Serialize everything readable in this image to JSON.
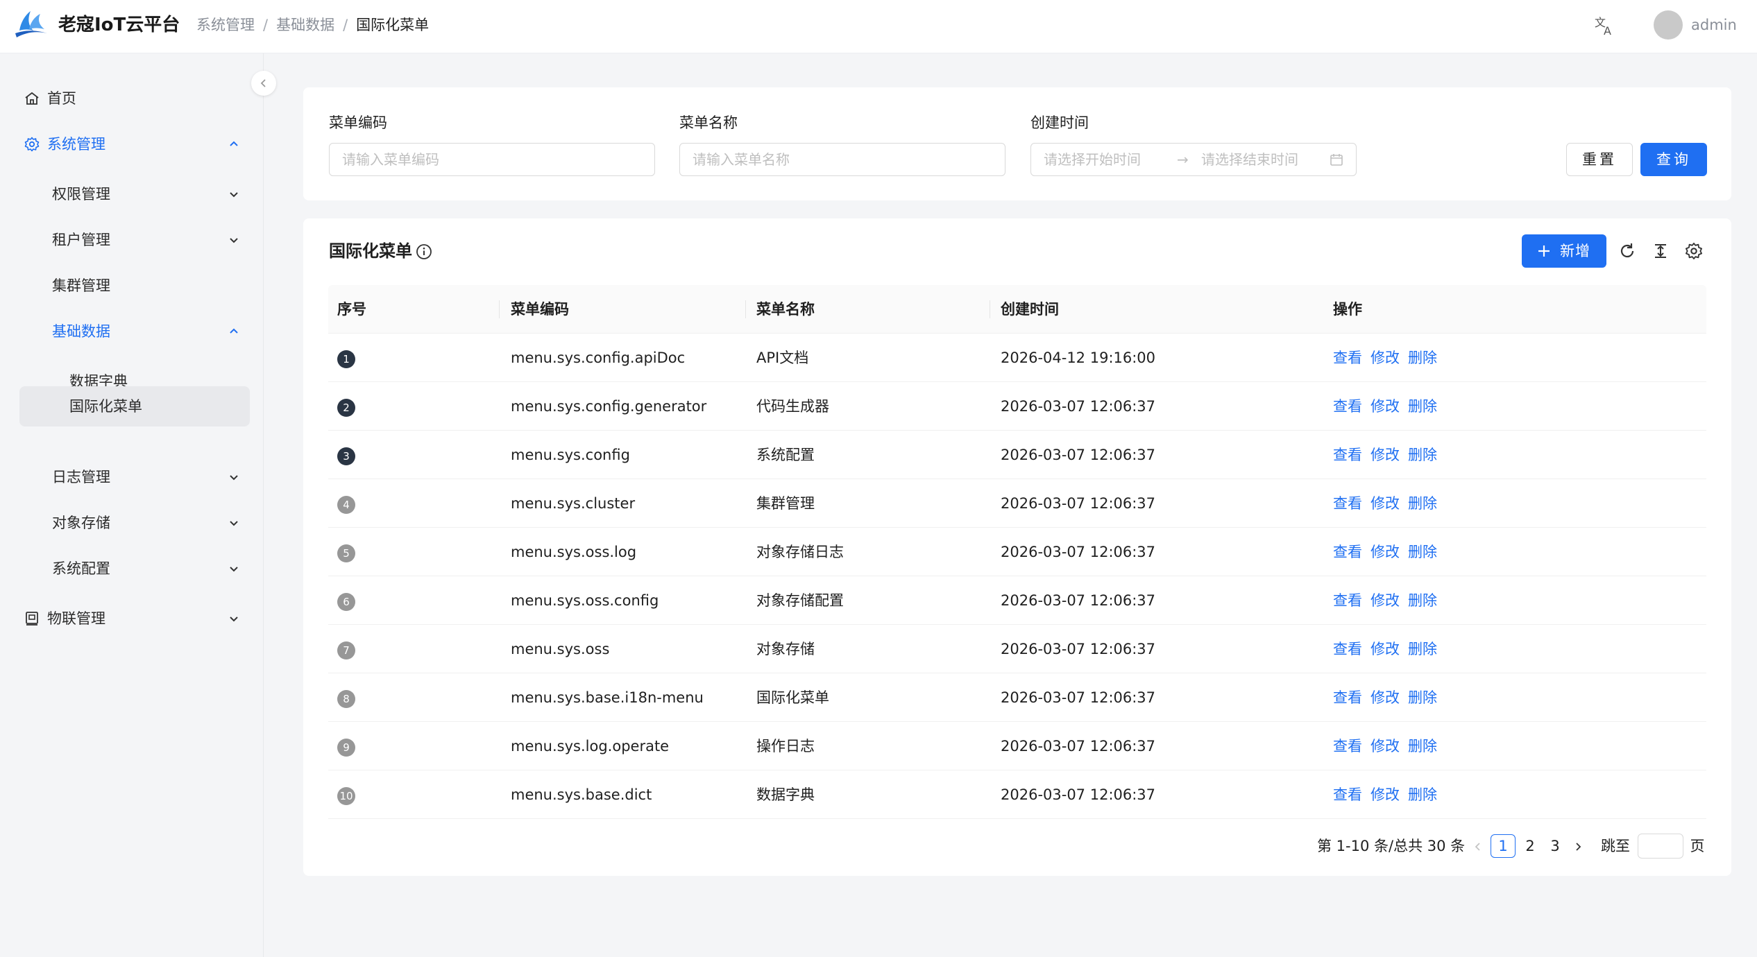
{
  "header": {
    "app_title": "老寇IoT云平台",
    "breadcrumb": [
      "系统管理",
      "基础数据",
      "国际化菜单"
    ],
    "separator": "/",
    "username": "admin"
  },
  "sidebar": {
    "items": [
      {
        "label": "首页",
        "icon": "home-icon"
      },
      {
        "label": "系统管理",
        "icon": "gear-icon",
        "expanded": true
      },
      {
        "label": "权限管理"
      },
      {
        "label": "租户管理"
      },
      {
        "label": "集群管理"
      },
      {
        "label": "基础数据",
        "expanded": true
      },
      {
        "label": "数据字典"
      },
      {
        "label": "国际化菜单",
        "selected": true
      },
      {
        "label": "日志管理"
      },
      {
        "label": "对象存储"
      },
      {
        "label": "系统配置"
      },
      {
        "label": "物联管理",
        "icon": "device-icon"
      }
    ]
  },
  "search": {
    "code_label": "菜单编码",
    "code_placeholder": "请输入菜单编码",
    "name_label": "菜单名称",
    "name_placeholder": "请输入菜单名称",
    "time_label": "创建时间",
    "start_placeholder": "请选择开始时间",
    "range_separator": "→",
    "end_placeholder": "请选择结束时间",
    "reset_label": "重置",
    "query_label": "查询"
  },
  "table": {
    "title": "国际化菜单",
    "add_label": "新增",
    "columns": [
      "序号",
      "菜单编码",
      "菜单名称",
      "创建时间",
      "操作"
    ],
    "actions": [
      "查看",
      "修改",
      "删除"
    ],
    "rows": [
      {
        "idx": "1",
        "code": "menu.sys.config.apiDoc",
        "name": "API文档",
        "time": "2026-04-12 19:16:00"
      },
      {
        "idx": "2",
        "code": "menu.sys.config.generator",
        "name": "代码生成器",
        "time": "2026-03-07 12:06:37"
      },
      {
        "idx": "3",
        "code": "menu.sys.config",
        "name": "系统配置",
        "time": "2026-03-07 12:06:37"
      },
      {
        "idx": "4",
        "code": "menu.sys.cluster",
        "name": "集群管理",
        "time": "2026-03-07 12:06:37"
      },
      {
        "idx": "5",
        "code": "menu.sys.oss.log",
        "name": "对象存储日志",
        "time": "2026-03-07 12:06:37"
      },
      {
        "idx": "6",
        "code": "menu.sys.oss.config",
        "name": "对象存储配置",
        "time": "2026-03-07 12:06:37"
      },
      {
        "idx": "7",
        "code": "menu.sys.oss",
        "name": "对象存储",
        "time": "2026-03-07 12:06:37"
      },
      {
        "idx": "8",
        "code": "menu.sys.base.i18n-menu",
        "name": "国际化菜单",
        "time": "2026-03-07 12:06:37"
      },
      {
        "idx": "9",
        "code": "menu.sys.log.operate",
        "name": "操作日志",
        "time": "2026-03-07 12:06:37"
      },
      {
        "idx": "10",
        "code": "menu.sys.base.dict",
        "name": "数据字典",
        "time": "2026-03-07 12:06:37"
      }
    ]
  },
  "pagination": {
    "total_text": "第 1-10 条/总共 30 条",
    "pages": [
      "1",
      "2",
      "3"
    ],
    "current": "1",
    "jump_label": "跳至",
    "page_suffix": "页"
  },
  "colors": {
    "accent": "#1f6ff2",
    "index_dark": "#2a3544",
    "index_grey": "#979797"
  }
}
